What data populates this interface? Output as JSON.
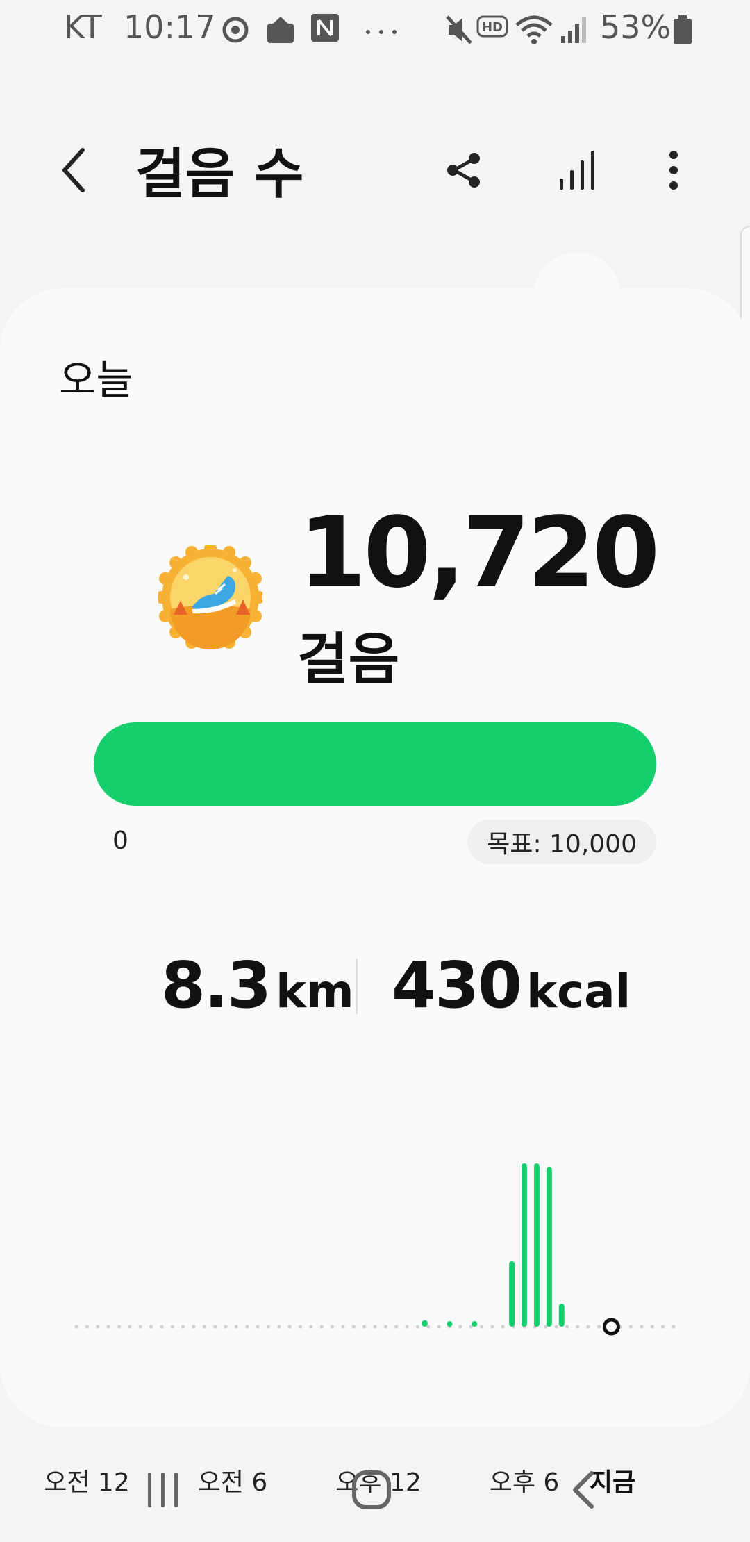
{
  "status_bar": {
    "carrier": "KT",
    "time": "10:17",
    "battery": "53%",
    "icons": [
      "sync-icon",
      "mail-icon",
      "naver-icon",
      "more-dots-icon",
      "mute-icon",
      "hd-icon",
      "wifi-icon",
      "signal-icon",
      "battery-icon"
    ]
  },
  "app_bar": {
    "title": "걸음 수",
    "icons": [
      "back-arrow-icon",
      "share-icon",
      "trends-icon",
      "more-vertical-icon"
    ]
  },
  "today": {
    "label": "오늘",
    "steps": "10,720",
    "steps_unit": "걸음",
    "progress_fraction": 1.0,
    "progress_min": "0",
    "goal": "목표: 10,000",
    "distance_value": "8.3",
    "distance_unit": "km",
    "calories_value": "430",
    "calories_unit": "kcal"
  },
  "chart_data": {
    "type": "bar",
    "x_ticks": [
      "오전 12",
      "오전 6",
      "오후 12",
      "오후 6",
      "지금"
    ],
    "bars": [
      {
        "hour": 14.0,
        "value": 0.04
      },
      {
        "hour": 15.0,
        "value": 0.03
      },
      {
        "hour": 16.0,
        "value": 0.03
      },
      {
        "hour": 17.5,
        "value": 0.4
      },
      {
        "hour": 18.0,
        "value": 1.0
      },
      {
        "hour": 18.5,
        "value": 1.0
      },
      {
        "hour": 19.0,
        "value": 0.98
      },
      {
        "hour": 19.5,
        "value": 0.14
      }
    ],
    "now_hour": 21.5,
    "colors": {
      "bar": "#15cf6e",
      "dots": "#d0d0d0"
    }
  },
  "colors": {
    "accent": "#15cf6e",
    "medal_orange": "#f5a623"
  },
  "nav_bar": {
    "icons": [
      "recents-icon",
      "home-icon",
      "nav-back-icon"
    ]
  }
}
